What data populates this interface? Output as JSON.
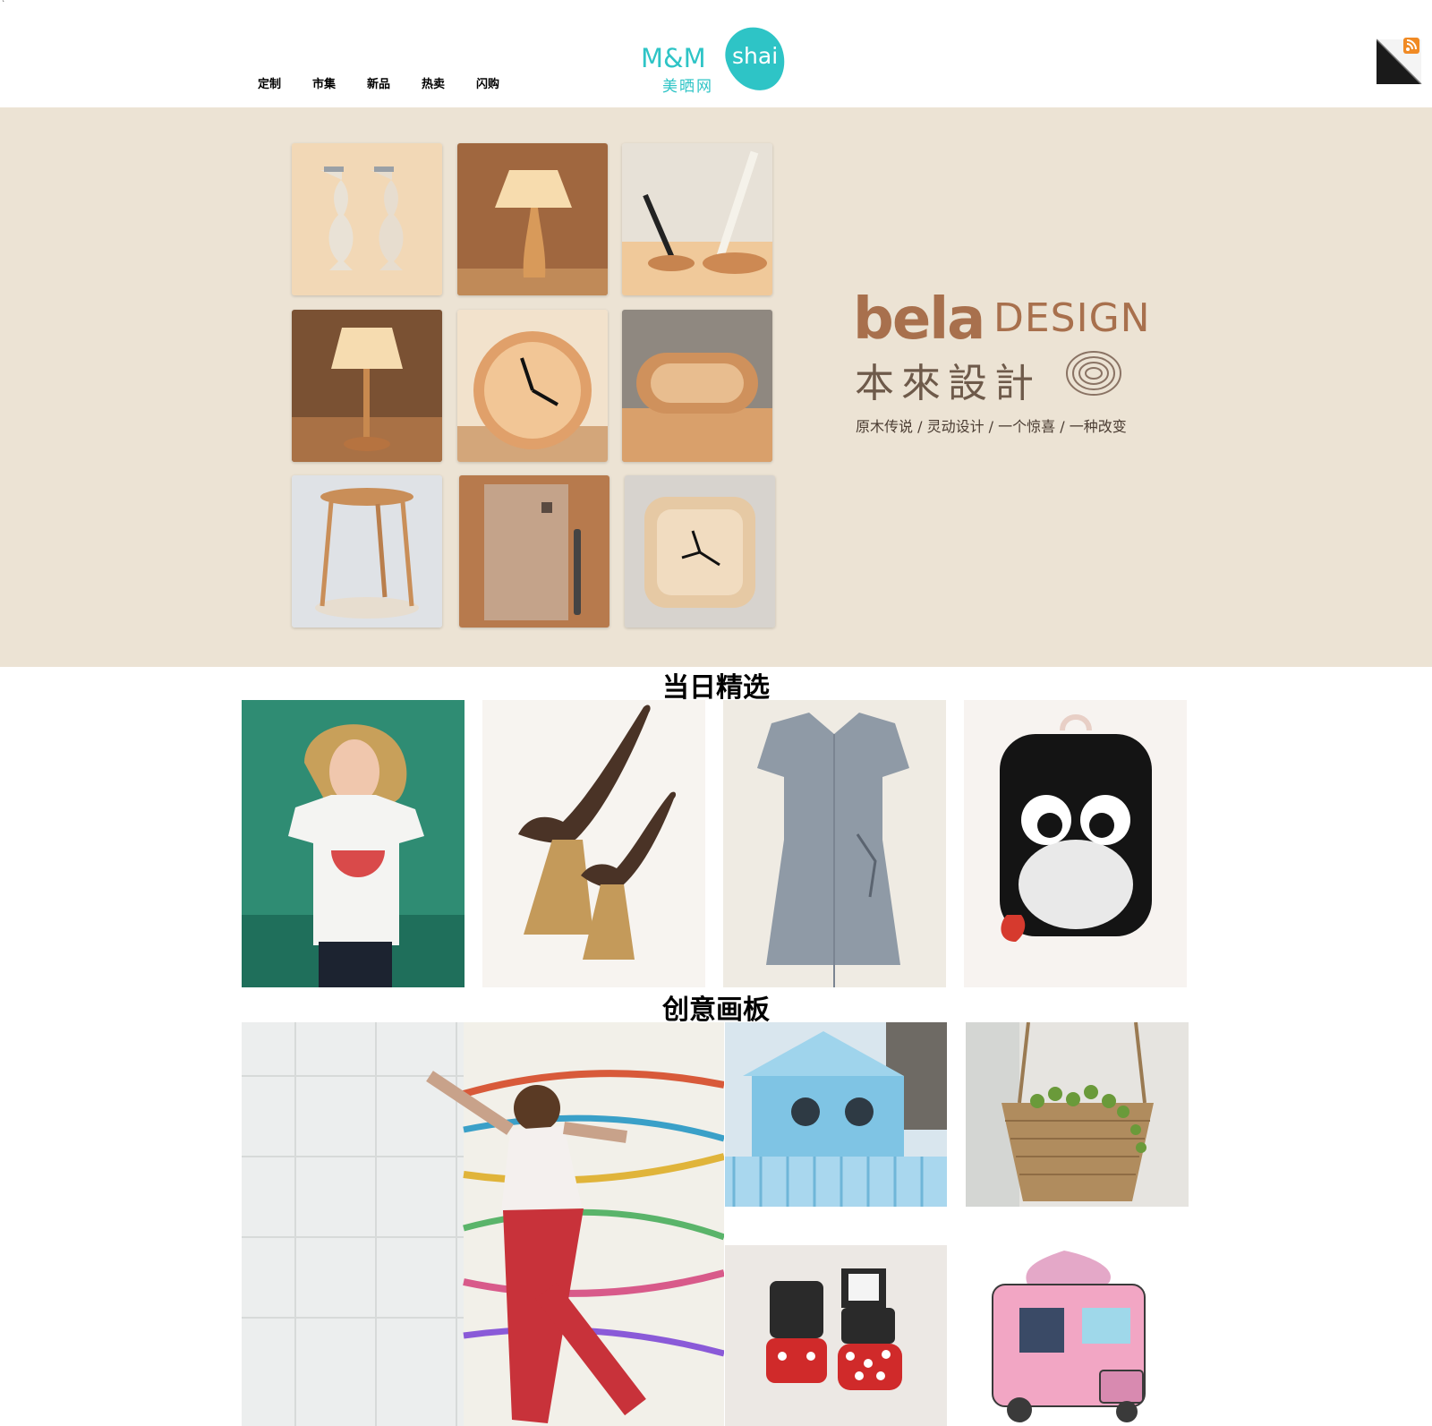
{
  "header": {
    "nav": [
      "定制",
      "市集",
      "新品",
      "热卖",
      "闪购"
    ],
    "logo": {
      "latin": "M&M",
      "shai": "shai",
      "chinese": "美晒网"
    },
    "icons": [
      "rss-icon"
    ]
  },
  "banner": {
    "brand_name": "bela",
    "brand_suffix": "DESIGN",
    "brand_cn": "本來設計",
    "slogan": "原木传说 / 灵动设计 / 一个惊喜 / 一种改变",
    "products": [
      "candle-holders",
      "table-lamp",
      "pen-holders",
      "bedside-lamp",
      "wall-clock",
      "speaker",
      "stool",
      "notebook",
      "desk-clock"
    ]
  },
  "sections": {
    "daily_title": "当日精选",
    "creative_title": "创意画板",
    "daily_items": [
      "watermelon-tshirt",
      "wooden-birds",
      "gray-wrap-dress",
      "monkey-backpack"
    ],
    "creative_items": [
      "paint-artist",
      "blue-wooden-house",
      "hanging-rope-planter",
      "mickey-drawer-cabinets",
      "ice-cream-truck"
    ]
  },
  "colors": {
    "accent": "#2ec4c6",
    "banner_bg": "#ece3d4",
    "brand_brown": "#a8704d"
  }
}
